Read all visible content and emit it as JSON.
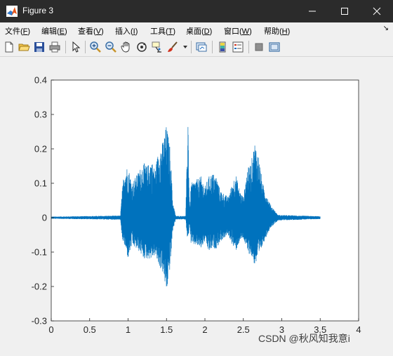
{
  "window": {
    "title": "Figure 3"
  },
  "menu": [
    {
      "label": "文件(",
      "key": "F",
      "tail": ")"
    },
    {
      "label": "编辑(",
      "key": "E",
      "tail": ")"
    },
    {
      "label": "查看(",
      "key": "V",
      "tail": ")"
    },
    {
      "label": "插入(",
      "key": "I",
      "tail": ")"
    },
    {
      "label": "工具(",
      "key": "T",
      "tail": ")"
    },
    {
      "label": "桌面(",
      "key": "D",
      "tail": ")"
    },
    {
      "label": "窗口(",
      "key": "W",
      "tail": ")"
    },
    {
      "label": "帮助(",
      "key": "H",
      "tail": ")"
    }
  ],
  "toolbar_icons": [
    "new-figure-icon",
    "open-file-icon",
    "save-icon",
    "print-icon",
    "edit-plot-arrow-icon",
    "zoom-in-icon",
    "zoom-out-icon",
    "pan-hand-icon",
    "rotate-3d-icon",
    "data-cursor-icon",
    "brush-icon",
    "brush-dropdown-icon",
    "link-plot-icon",
    "insert-colorbar-icon",
    "insert-legend-icon",
    "hide-plot-tools-icon",
    "show-plot-tools-icon"
  ],
  "chart_data": {
    "type": "line",
    "title": "",
    "xlabel": "",
    "ylabel": "",
    "xlim": [
      0,
      4
    ],
    "ylim": [
      -0.3,
      0.4
    ],
    "xticks": [
      "0",
      "0.5",
      "1",
      "1.5",
      "2",
      "2.5",
      "3",
      "3.5",
      "4"
    ],
    "yticks": [
      "-0.3",
      "-0.2",
      "-0.1",
      "0",
      "0.1",
      "0.2",
      "0.3",
      "0.4"
    ],
    "grid": false,
    "line_color": "#0072BD",
    "series": [
      {
        "x_range": [
          0,
          3.5
        ],
        "envelope": [
          [
            0.0,
            0.003,
            -0.003
          ],
          [
            0.6,
            0.005,
            -0.005
          ],
          [
            0.9,
            0.006,
            -0.006
          ],
          [
            0.92,
            0.07,
            -0.06
          ],
          [
            0.95,
            0.14,
            -0.08
          ],
          [
            1.0,
            0.15,
            -0.12
          ],
          [
            1.05,
            0.1,
            -0.08
          ],
          [
            1.1,
            0.12,
            -0.09
          ],
          [
            1.15,
            0.14,
            -0.1
          ],
          [
            1.2,
            0.16,
            -0.12
          ],
          [
            1.25,
            0.15,
            -0.12
          ],
          [
            1.3,
            0.17,
            -0.12
          ],
          [
            1.35,
            0.14,
            -0.11
          ],
          [
            1.4,
            0.2,
            -0.14
          ],
          [
            1.45,
            0.22,
            -0.16
          ],
          [
            1.5,
            0.27,
            -0.22
          ],
          [
            1.55,
            0.2,
            -0.14
          ],
          [
            1.58,
            0.05,
            -0.04
          ],
          [
            1.62,
            0.005,
            -0.005
          ],
          [
            1.75,
            0.005,
            -0.005
          ],
          [
            1.78,
            0.31,
            -0.08
          ],
          [
            1.8,
            0.02,
            -0.02
          ],
          [
            1.82,
            0.1,
            -0.08
          ],
          [
            1.88,
            0.11,
            -0.08
          ],
          [
            1.95,
            0.12,
            -0.09
          ],
          [
            2.0,
            0.09,
            -0.07
          ],
          [
            2.05,
            0.12,
            -0.1
          ],
          [
            2.1,
            0.13,
            -0.09
          ],
          [
            2.15,
            0.12,
            -0.09
          ],
          [
            2.2,
            0.08,
            -0.07
          ],
          [
            2.3,
            0.06,
            -0.05
          ],
          [
            2.4,
            0.13,
            -0.1
          ],
          [
            2.45,
            0.08,
            -0.07
          ],
          [
            2.5,
            0.06,
            -0.06
          ],
          [
            2.55,
            0.14,
            -0.1
          ],
          [
            2.6,
            0.16,
            -0.11
          ],
          [
            2.65,
            0.22,
            -0.14
          ],
          [
            2.7,
            0.18,
            -0.12
          ],
          [
            2.75,
            0.1,
            -0.08
          ],
          [
            2.85,
            0.04,
            -0.03
          ],
          [
            2.95,
            0.008,
            -0.008
          ],
          [
            3.5,
            0.004,
            -0.004
          ]
        ]
      }
    ]
  },
  "watermark": "CSDN @秋风知我意i"
}
